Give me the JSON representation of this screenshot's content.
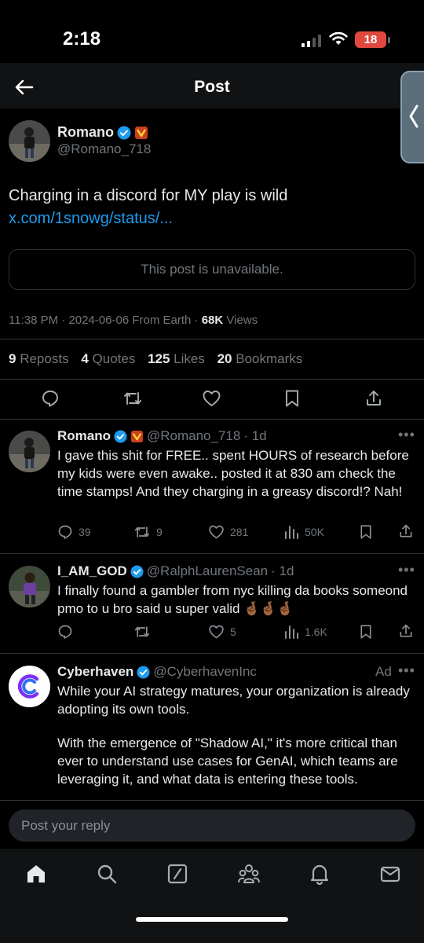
{
  "status_bar": {
    "time": "2:18",
    "battery": "18"
  },
  "header": {
    "title": "Post"
  },
  "post": {
    "author_name": "Romano",
    "author_handle": "@Romano_718",
    "text": "Charging in a discord for MY play is wild ",
    "link_text": "x.com/1snowg/status/...",
    "quoted_unavailable": "This post is unavailable.",
    "meta": {
      "time": "11:38 PM",
      "date": "2024-06-06",
      "source": "From Earth",
      "views_count": "68K",
      "views_label": "Views"
    },
    "stats": [
      {
        "count": "9",
        "label": "Reposts"
      },
      {
        "count": "4",
        "label": "Quotes"
      },
      {
        "count": "125",
        "label": "Likes"
      },
      {
        "count": "20",
        "label": "Bookmarks"
      }
    ]
  },
  "replies": [
    {
      "name": "Romano",
      "handle": "@Romano_718",
      "age": "· 1d",
      "text": "I gave this shit for FREE.. spent HOURS of research before my kids were even awake.. posted it at 830 am check the time stamps! And they charging in a greasy discord!? Nah!",
      "replies": "39",
      "reposts": "9",
      "likes": "281",
      "views": "50K"
    },
    {
      "name": "I_AM_GOD",
      "handle": "@RalphLaurenSean",
      "age": "· 1d",
      "text": "I finally found a gambler from nyc killing da books someond pmo to u bro said u super valid 🤞🏾🤞🏾🤞🏾",
      "replies": "",
      "reposts": "",
      "likes": "5",
      "views": "1.6K"
    },
    {
      "name": "Cyberhaven",
      "handle": "@CyberhavenInc",
      "ad_label": "Ad",
      "text_1": "While your AI strategy matures, your organization is already adopting its own tools.",
      "text_2": "With the emergence of \"Shadow AI,\" it's more critical than ever to understand use cases for GenAI, which teams are leveraging it, and what data is entering these tools."
    }
  ],
  "reply_box": {
    "placeholder": "Post your reply"
  },
  "colors": {
    "accent": "#1d9bf0",
    "muted": "#71767b",
    "battery": "#e0483f"
  },
  "icons": [
    "back-arrow-icon",
    "comment-icon",
    "repost-icon",
    "like-icon",
    "bookmark-icon",
    "share-icon",
    "views-icon",
    "home-icon",
    "search-icon",
    "grok-icon",
    "communities-icon",
    "notifications-icon",
    "messages-icon"
  ]
}
